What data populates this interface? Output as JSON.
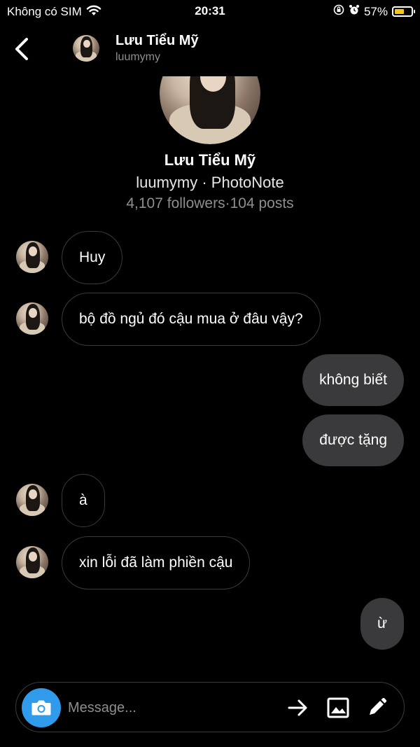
{
  "status_bar": {
    "carrier": "Không có SIM",
    "time": "20:31",
    "battery": "57%",
    "battery_level": 0.57,
    "battery_color": "#f5c518"
  },
  "header": {
    "name": "Lưu Tiểu Mỹ",
    "handle": "luumymy"
  },
  "profile": {
    "name": "Lưu Tiểu Mỹ",
    "subtitle": "luumymy · PhotoNote",
    "stats": "4,107 followers·104 posts"
  },
  "messages": [
    {
      "from": "them",
      "text": "Huy"
    },
    {
      "from": "them",
      "text": "bộ đồ ngủ đó cậu mua ở đâu vậy?"
    },
    {
      "from": "me",
      "text": "không biết"
    },
    {
      "from": "me",
      "text": "được tặng"
    },
    {
      "from": "them",
      "text": "à"
    },
    {
      "from": "them",
      "text": "xin lỗi đã làm phiền cậu"
    },
    {
      "from": "me",
      "text": "ừ"
    }
  ],
  "composer": {
    "placeholder": "Message...",
    "camera_color": "#2f9bea"
  },
  "icons": [
    "back-chevron-icon",
    "wifi-icon",
    "lock-rotation-icon",
    "alarm-icon",
    "battery-icon",
    "camera-icon",
    "send-arrow-icon",
    "gallery-icon",
    "pencil-icon"
  ]
}
